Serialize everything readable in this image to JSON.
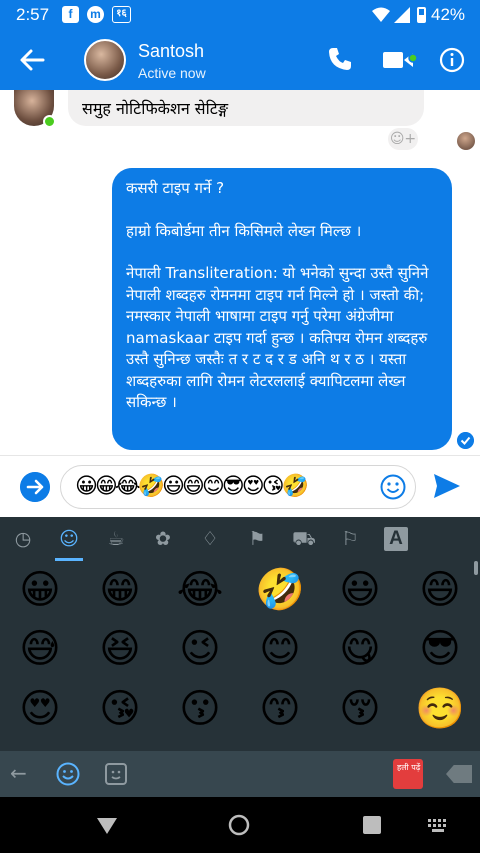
{
  "status_bar": {
    "time": "2:57",
    "app_icons": [
      "f",
      "m",
      "१६"
    ],
    "battery": "42%"
  },
  "header": {
    "contact_name": "Santosh",
    "presence": "Active now",
    "icons": [
      "back-arrow-icon",
      "phone-icon",
      "video-call-icon",
      "info-icon"
    ]
  },
  "chat": {
    "incoming_message": "समुह नोटिफिकेशन सेटिङ्ग",
    "outgoing_message": {
      "lines": [
        "कसरी टाइप गर्ने ?",
        "",
        "हाम्रो किबोर्डमा तीन किसिमले लेख्न मिल्छ ।",
        "",
        "नेपाली Transliteration: यो भनेको सुन्दा उस्तै सुनिने नेपाली शब्दहरु रोमनमा टाइप गर्न मिल्ने हो । जस्तो की; नमस्कार नेपाली भाषामा टाइप गर्नु परेमा अंग्रेजीमा namaskaar टाइप गर्दा हुन्छ । कतिपय रोमन शब्दहरु उस्तै सुनिन्छ जस्तैः त र ट द र ड अनि थ र ठ । यस्ता शब्दहरुका लागि रोमन लेटरललाई क्यापिटलमा लेख्न सकिन्छ ।"
      ]
    }
  },
  "composer": {
    "input_value": "😀😁😂🤣😃😄😊😎😍😘🤣"
  },
  "keyboard": {
    "tabs": [
      "recent-icon",
      "smiley-icon",
      "food-icon",
      "nature-icon",
      "objects-icon",
      "places-icon",
      "travel-icon",
      "flags-icon",
      "symbols-icon"
    ],
    "symbols_tab_label": "A",
    "emoji_rows": [
      [
        "😀",
        "😁",
        "😂",
        "🤣",
        "😃",
        "😄"
      ],
      [
        "😅",
        "😆",
        "😉",
        "😊",
        "😋",
        "😎"
      ],
      [
        "😍",
        "😘",
        "😗",
        "😙",
        "😚",
        "☺️"
      ]
    ],
    "extension_label": "हली पढ़ें"
  },
  "colors": {
    "brand_blue": "#0d7ce6",
    "keyboard_dark": "#263238",
    "keyboard_accent": "#5ab4ff"
  }
}
